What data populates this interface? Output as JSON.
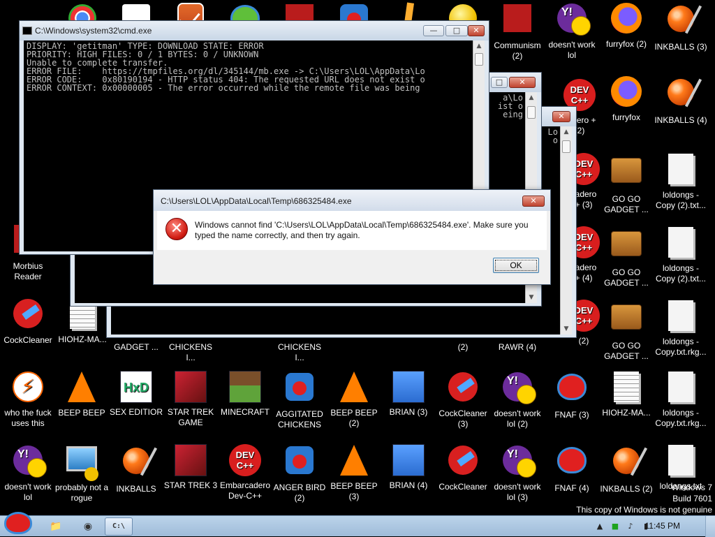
{
  "desktop": {
    "icons": [
      {
        "label": "Morbius Reader"
      },
      {
        "label": "CockCleaner"
      },
      {
        "label": "HIOHZ-MA..."
      },
      {
        "label": "who the fuck uses this"
      },
      {
        "label": "BEEP BEEP"
      },
      {
        "label": "SEX EDITIOR"
      },
      {
        "label": "STAR TREK GAME"
      },
      {
        "label": "MINECRAFT"
      },
      {
        "label": "AGGITATED CHICKENS I..."
      },
      {
        "label": "BEEP BEEP (2)"
      },
      {
        "label": "BRIAN (3)"
      },
      {
        "label": "CockCleaner (3)"
      },
      {
        "label": "doesn't work lol (2)"
      },
      {
        "label": "FNAF (3)"
      },
      {
        "label": "HIOHZ-MA..."
      },
      {
        "label": "loldongs - Copy.txt.rkg..."
      },
      {
        "label": "doesn't work lol"
      },
      {
        "label": "probably not a rogue"
      },
      {
        "label": "INKBALLS"
      },
      {
        "label": "STAR TREK 3"
      },
      {
        "label": "Embarcadero Dev-C++"
      },
      {
        "label": "ANGER BIRD (2)"
      },
      {
        "label": "BEEP BEEP (3)"
      },
      {
        "label": "BRIAN (4)"
      },
      {
        "label": "CockCleaner"
      },
      {
        "label": "doesn't work lol (3)"
      },
      {
        "label": "FNAF (4)"
      },
      {
        "label": "INKBALLS (2)"
      },
      {
        "label": "loldongs.txt"
      },
      {
        "label": "Communism (2)"
      },
      {
        "label": "doesn't work lol"
      },
      {
        "label": "furryfox (2)"
      },
      {
        "label": "INKBALLS (3)"
      },
      {
        "label": "cadero + (2)"
      },
      {
        "label": "furryfox"
      },
      {
        "label": "INKBALLS (4)"
      },
      {
        "label": "cadero + (3)"
      },
      {
        "label": "GO GO GADGET ..."
      },
      {
        "label": "loldongs - Copy (2).txt..."
      },
      {
        "label": "cadero + (4)"
      },
      {
        "label": "GO GO GADGET ..."
      },
      {
        "label": "loldongs - Copy (2).txt..."
      },
      {
        "label": "(2)"
      },
      {
        "label": "GO GO GADGET ..."
      },
      {
        "label": "loldongs - Copy.txt.rkg..."
      },
      {
        "label": "GADGET ..."
      },
      {
        "label": "CHICKENS I..."
      },
      {
        "label": "CHICKENS I..."
      },
      {
        "label": "(2)"
      },
      {
        "label": "RAWR (4)"
      }
    ]
  },
  "cmd": {
    "title": "C:\\Windows\\system32\\cmd.exe",
    "lines": [
      "DISPLAY: 'getitman' TYPE: DOWNLOAD STATE: ERROR",
      "PRIORITY: HIGH FILES: 0 / 1 BYTES: 0 / UNKNOWN",
      "Unable to complete transfer.",
      "ERROR FILE:    https://tmpfiles.org/dl/345144/mb.exe -> C:\\Users\\LOL\\AppData\\Lo",
      "ERROR CODE:    0x80190194 - HTTP status 404: The requested URL does not exist o",
      "ERROR CONTEXT: 0x00000005 - The error occurred while the remote file was being"
    ],
    "back_fragment": "a\\Lo\nist o\neing",
    "back_fragment2": "Lo\no"
  },
  "dialog": {
    "title": "C:\\Users\\LOL\\AppData\\Local\\Temp\\686325484.exe",
    "message": "Windows cannot find 'C:\\Users\\LOL\\AppData\\Local\\Temp\\686325484.exe'. Make sure you typed the name correctly, and then try again.",
    "ok_label": "OK",
    "close_glyph": "✕"
  },
  "window_controls": {
    "minimize": "—",
    "maximize": "□",
    "close": "✕"
  },
  "taskbar": {
    "buttons": [
      {
        "name": "explorer",
        "glyph": "📁"
      },
      {
        "name": "chrome",
        "glyph": "◉"
      },
      {
        "name": "cmd",
        "glyph": "C:\\"
      }
    ],
    "tray_icons": [
      "▲",
      "■",
      "♪",
      "▮"
    ],
    "clock": "11:45 PM"
  },
  "watermark": {
    "line1": "Windows 7",
    "line2": "Build 7601",
    "line3": "This copy of Windows is not genuine"
  }
}
